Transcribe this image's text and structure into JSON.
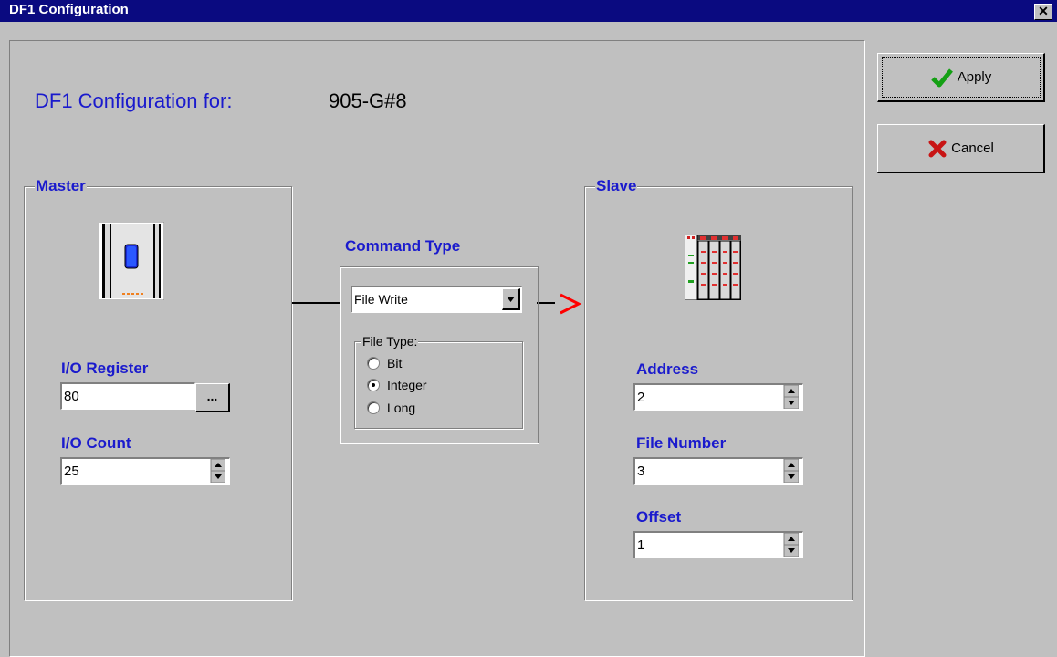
{
  "window": {
    "title": "DF1 Configuration",
    "close_glyph": "✕"
  },
  "heading": {
    "label": "DF1 Configuration for:",
    "device": "905-G#8"
  },
  "master": {
    "group_title": "Master",
    "io_register_label": "I/O Register",
    "io_register_value": "80",
    "browse_label": "...",
    "io_count_label": "I/O Count",
    "io_count_value": "25"
  },
  "command": {
    "title": "Command Type",
    "selected": "File Write",
    "file_type_legend": "File Type:",
    "options": [
      "Bit",
      "Integer",
      "Long"
    ],
    "selected_option": "Integer"
  },
  "slave": {
    "group_title": "Slave",
    "address_label": "Address",
    "address_value": "2",
    "file_number_label": "File Number",
    "file_number_value": "3",
    "offset_label": "Offset",
    "offset_value": "1"
  },
  "buttons": {
    "apply": "Apply",
    "cancel": "Cancel"
  },
  "colors": {
    "accent_blue": "#1a1acd",
    "titlebar": "#0a0a80",
    "arrow_red": "#ff0000",
    "check_green": "#14a014",
    "cancel_red": "#c81414"
  },
  "icons": {
    "master_device": "plc-module-icon",
    "slave_device": "rack-module-icon",
    "apply": "checkmark-icon",
    "cancel": "x-icon",
    "arrow": "right-arrow-icon"
  }
}
